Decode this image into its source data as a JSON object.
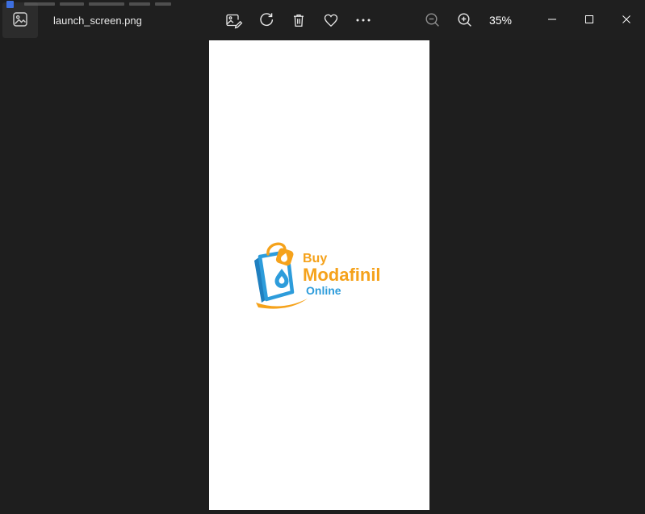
{
  "window": {
    "filename": "launch_screen.png",
    "zoom_level": "35%"
  },
  "toolbar": {
    "icons": [
      "edit-image",
      "rotate",
      "delete",
      "favorite",
      "more",
      "zoom-out",
      "zoom-in"
    ]
  },
  "image": {
    "logo": {
      "line1": "Buy",
      "line2": "Modafinil",
      "line3": "Online"
    }
  },
  "colors": {
    "logo_orange": "#F5A21B",
    "logo_blue": "#2D9CDB",
    "titlebar_bg": "#1F1F1F",
    "viewer_bg": "#1E1E1E",
    "canvas_bg": "#FFFFFF",
    "icon_light": "#E8E8E8",
    "icon_dim": "#8F8F8F"
  }
}
